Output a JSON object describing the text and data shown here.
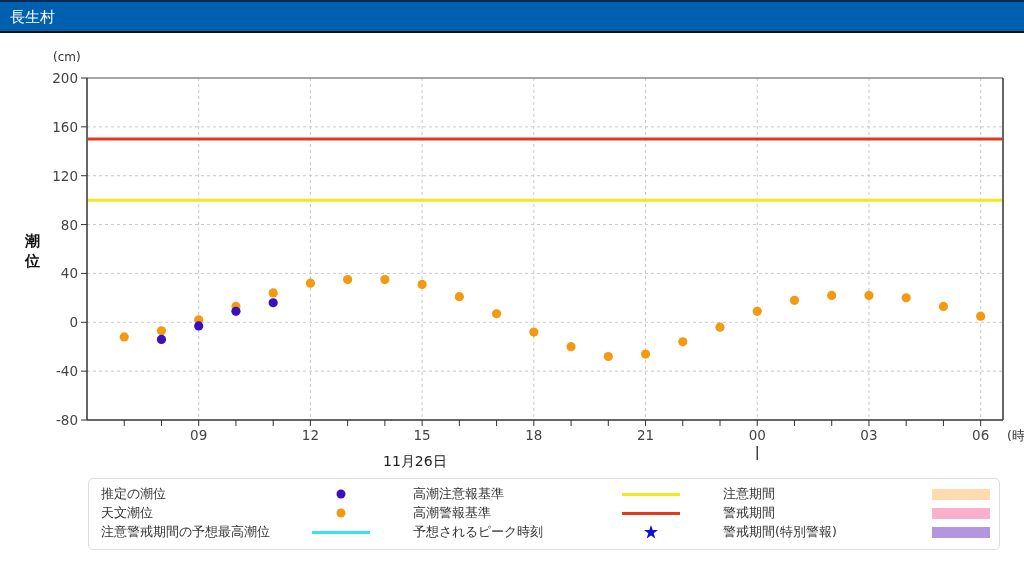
{
  "title": "長生村",
  "chart": {
    "unit": "(cm)",
    "date_label": "11月26日",
    "next_day_hour_labels": [
      "00",
      "03",
      "06"
    ],
    "chart_data": {
      "type": "scatter",
      "ylabel": "潮位",
      "xlabel": "(時",
      "xlim": [
        6,
        30.6
      ],
      "ylim": [
        -80,
        200
      ],
      "grid": true,
      "xticks": [
        {
          "value": 9,
          "label": "09"
        },
        12,
        15,
        18,
        21
      ],
      "yticks": [
        -80,
        -40,
        0,
        40,
        80,
        120,
        160,
        200
      ],
      "series": [
        {
          "color": "#f39a12",
          "x": [
            7,
            8,
            9,
            10,
            11,
            12,
            13,
            14,
            15,
            16,
            17,
            18,
            19,
            20,
            21,
            22,
            23,
            24,
            25,
            26,
            27,
            28,
            29,
            30
          ],
          "values": [
            -12,
            -7,
            2,
            13,
            24,
            32,
            35,
            35,
            31,
            21,
            7,
            -8,
            -20,
            -28,
            -26,
            -16,
            -4,
            9,
            18,
            22,
            22,
            20,
            13,
            5
          ]
        },
        {
          "color": "#3a0fc0",
          "x": [
            8,
            9,
            10,
            11
          ],
          "values": [
            -14,
            -3,
            9,
            16
          ]
        }
      ],
      "ref_lines": [
        {
          "axis": "y",
          "value": 150,
          "color": "#e8381c"
        },
        {
          "axis": "y",
          "value": 100,
          "color": "#eeea1c"
        }
      ]
    }
  },
  "legend": [
    {
      "label": "推定の潮位",
      "kind": "dot",
      "color": "#3a0fc0"
    },
    {
      "label": "高潮注意報基準",
      "kind": "line",
      "color": "#eeea1c"
    },
    {
      "label": "注意期間",
      "kind": "swatch",
      "color": "#fddcb0"
    },
    {
      "label": "天文潮位",
      "kind": "dot",
      "color": "#f39a12"
    },
    {
      "label": "高潮警報基準",
      "kind": "line",
      "color": "#e8381c"
    },
    {
      "label": "警戒期間",
      "kind": "swatch",
      "color": "#f8b0cc"
    },
    {
      "label": "注意警戒期間の予想最高潮位",
      "kind": "line",
      "color": "#3de0e8"
    },
    {
      "label": "予想されるピーク時刻",
      "kind": "star",
      "color": "#1010d0"
    },
    {
      "label": "警戒期間(特別警報)",
      "kind": "swatch",
      "color": "#b496e0"
    }
  ]
}
